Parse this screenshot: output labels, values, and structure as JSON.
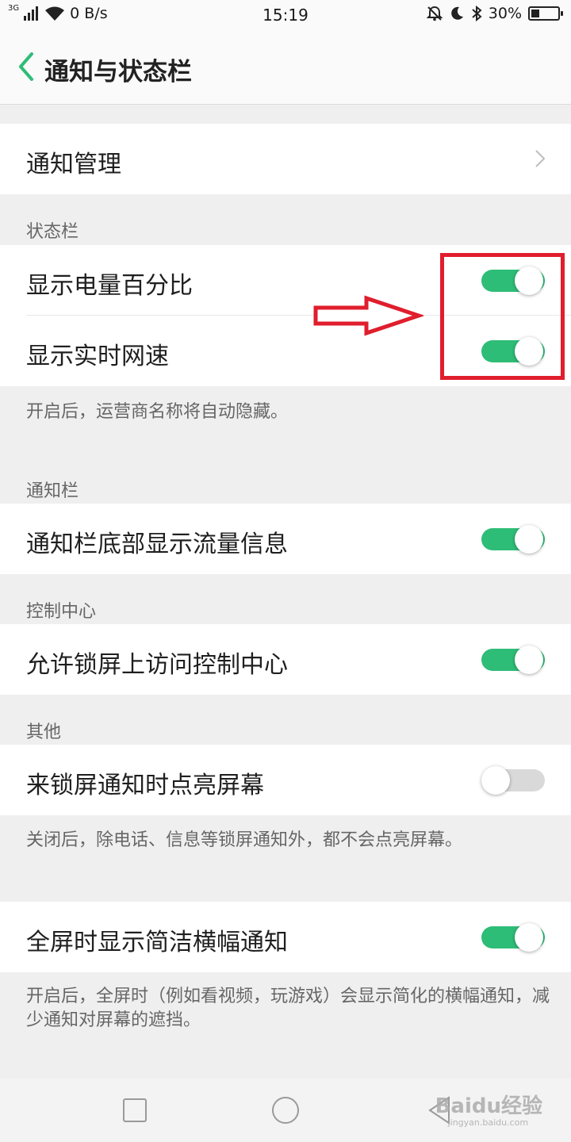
{
  "status_bar": {
    "network_type": "3G",
    "speed": "0 B/s",
    "time": "15:19",
    "battery": "30%",
    "battery_level": 0.3,
    "icons": [
      "signal-icon",
      "wifi-icon",
      "bell-off-icon",
      "moon-icon",
      "bluetooth-icon",
      "battery-icon"
    ]
  },
  "header": {
    "title": "通知与状态栏",
    "back_icon": "chevron-left-icon"
  },
  "items": {
    "notification_mgmt": "通知管理",
    "battery_percent": {
      "label": "显示电量百分比",
      "on": true
    },
    "network_speed": {
      "label": "显示实时网速",
      "on": true
    },
    "status_note": "开启后，运营商名称将自动隐藏。",
    "traffic_info": {
      "label": "通知栏底部显示流量信息",
      "on": true
    },
    "lockscreen_cc": {
      "label": "允许锁屏上访问控制中心",
      "on": true
    },
    "wake_on_notify": {
      "label": "来锁屏通知时点亮屏幕",
      "on": false
    },
    "wake_note": "关闭后，除电话、信息等锁屏通知外，都不会点亮屏幕。",
    "banner": {
      "label": "全屏时显示简洁横幅通知",
      "on": true
    },
    "banner_note": "开启后，全屏时（例如看视频，玩游戏）会显示简化的横幅通知，减少通知对屏幕的遮挡。"
  },
  "sections": {
    "status_bar": "状态栏",
    "notification_bar": "通知栏",
    "control_center": "控制中心",
    "other": "其他"
  },
  "watermark": {
    "brand": "Baidu经验",
    "site": "jingyan.baidu.com"
  },
  "colors": {
    "accent": "#2ebd77",
    "toggle_off": "#d9d9d9",
    "annotation": "#e01e2d",
    "background": "#efefef"
  }
}
